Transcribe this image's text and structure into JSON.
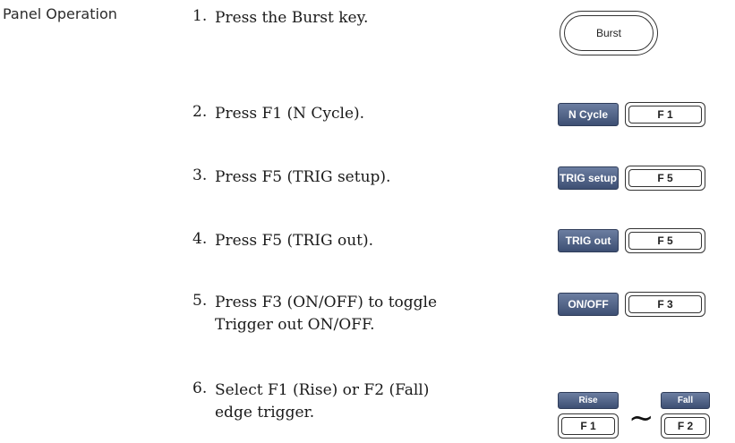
{
  "section_label": "Panel Operation",
  "steps": [
    {
      "num": "1.",
      "text": "Press the Burst key."
    },
    {
      "num": "2.",
      "text": "Press F1 (N Cycle)."
    },
    {
      "num": "3.",
      "text": "Press F5 (TRIG setup)."
    },
    {
      "num": "4.",
      "text": "Press F5 (TRIG out)."
    },
    {
      "num": "5.",
      "line1": "Press F3 (ON/OFF) to toggle",
      "line2": "Trigger out ON/OFF."
    },
    {
      "num": "6.",
      "line1": "Select F1 (Rise) or F2 (Fall)",
      "line2": "edge trigger."
    }
  ],
  "keys": {
    "burst": "Burst",
    "n_cycle": "N Cycle",
    "f1": "F 1",
    "trig_setup": "TRIG setup",
    "f5": "F 5",
    "trig_out": "TRIG out",
    "on_off": "ON/OFF",
    "f3": "F 3",
    "rise": "Rise",
    "fall": "Fall",
    "f2": "F 2",
    "separator": "~"
  }
}
